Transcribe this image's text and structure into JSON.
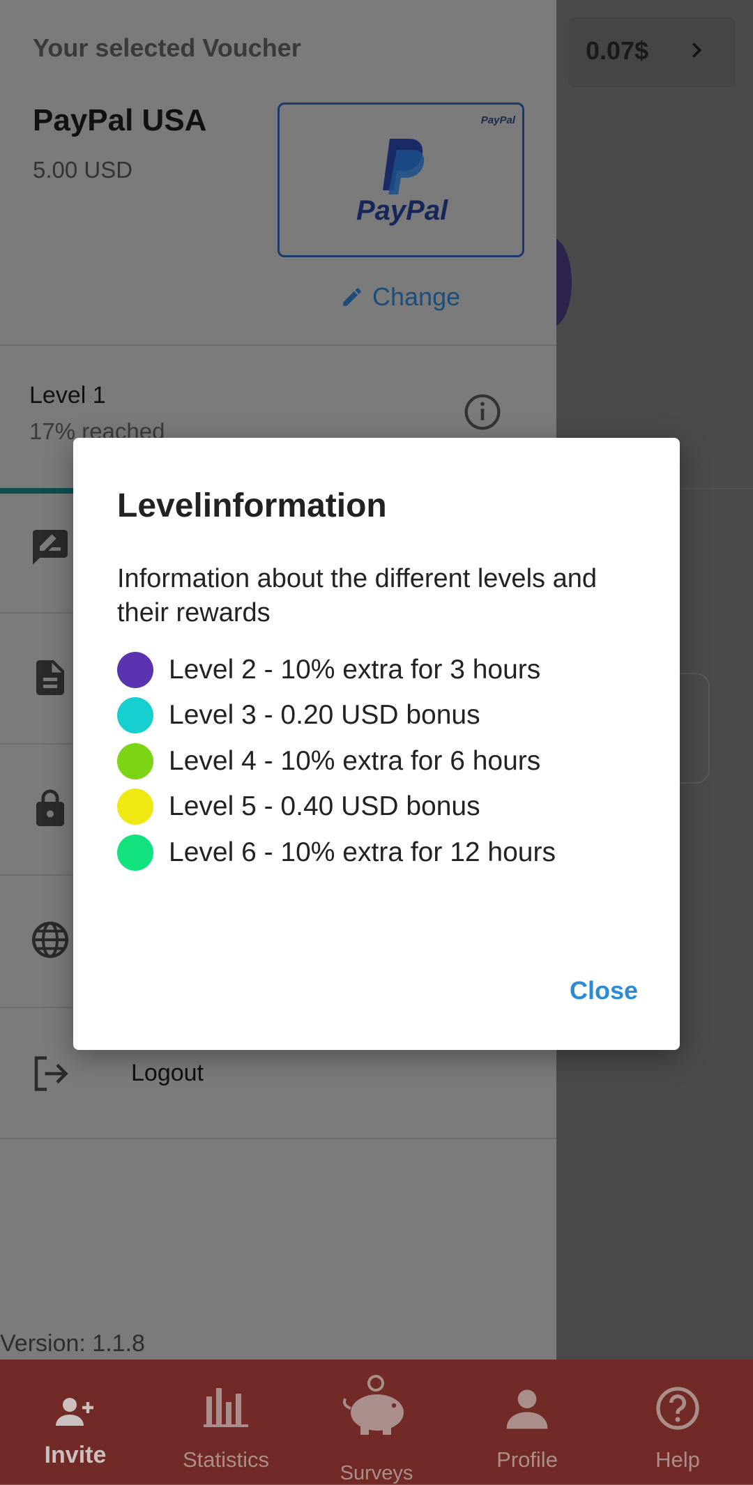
{
  "header": {
    "balance": "0.07$"
  },
  "drawer": {
    "voucher_title": "Your selected Voucher",
    "voucher_name": "PayPal USA",
    "voucher_amount": "5.00 USD",
    "card_small_brand": "PayPal",
    "card_big_brand": "PayPal",
    "change_label": "Change",
    "level_title": "Level 1",
    "level_progress": "17% reached",
    "level_progress_fraction": 0.17,
    "logout_label": "Logout",
    "version": "Version: 1.1.8"
  },
  "dialog": {
    "title": "Levelinformation",
    "description": "Information about the different levels and their rewards",
    "levels": [
      {
        "text": "Level 2 - 10% extra for 3 hours",
        "color": "#5a34b0"
      },
      {
        "text": "Level 3 - 0.20 USD bonus",
        "color": "#18cfcf"
      },
      {
        "text": "Level 4 - 10% extra for 6 hours",
        "color": "#7bd414"
      },
      {
        "text": "Level 5 - 0.40 USD bonus",
        "color": "#f0e812"
      },
      {
        "text": "Level 6 - 10% extra for 12 hours",
        "color": "#12e27e"
      }
    ],
    "close_label": "Close"
  },
  "bottom_nav": {
    "items": [
      {
        "label": "Invite",
        "icon": "invite-icon",
        "active": true
      },
      {
        "label": "Statistics",
        "icon": "statistics-icon",
        "active": false
      },
      {
        "label": "Surveys",
        "icon": "piggy-bank-icon",
        "active": false
      },
      {
        "label": "Profile",
        "icon": "profile-icon",
        "active": false
      },
      {
        "label": "Help",
        "icon": "help-icon",
        "active": false
      }
    ]
  },
  "colors": {
    "accent_blue": "#2c8bd6",
    "nav_background": "#712a26",
    "progress_teal": "#0f4f4f"
  }
}
